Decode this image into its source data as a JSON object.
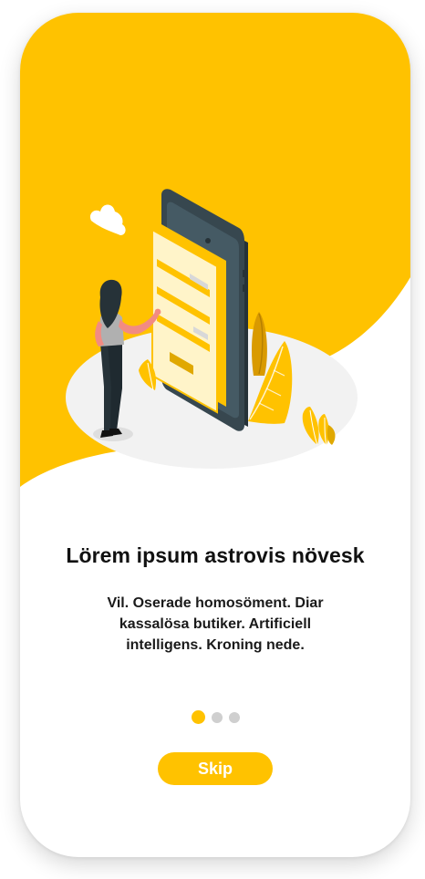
{
  "onboarding": {
    "title": "Lörem ipsum astrovis növesk",
    "description": "Vil. Oserade homosöment. Diar kassalösa butiker. Artificiell intelligens. Kroning nede.",
    "skip_label": "Skip",
    "pagination": {
      "total_pages": 3,
      "current_page": 1
    }
  },
  "colors": {
    "accent": "#ffc200",
    "dot_inactive": "#cfcfcf",
    "text": "#111111"
  },
  "illustration": {
    "icon": "woman-using-giant-smartphone-illustration"
  }
}
